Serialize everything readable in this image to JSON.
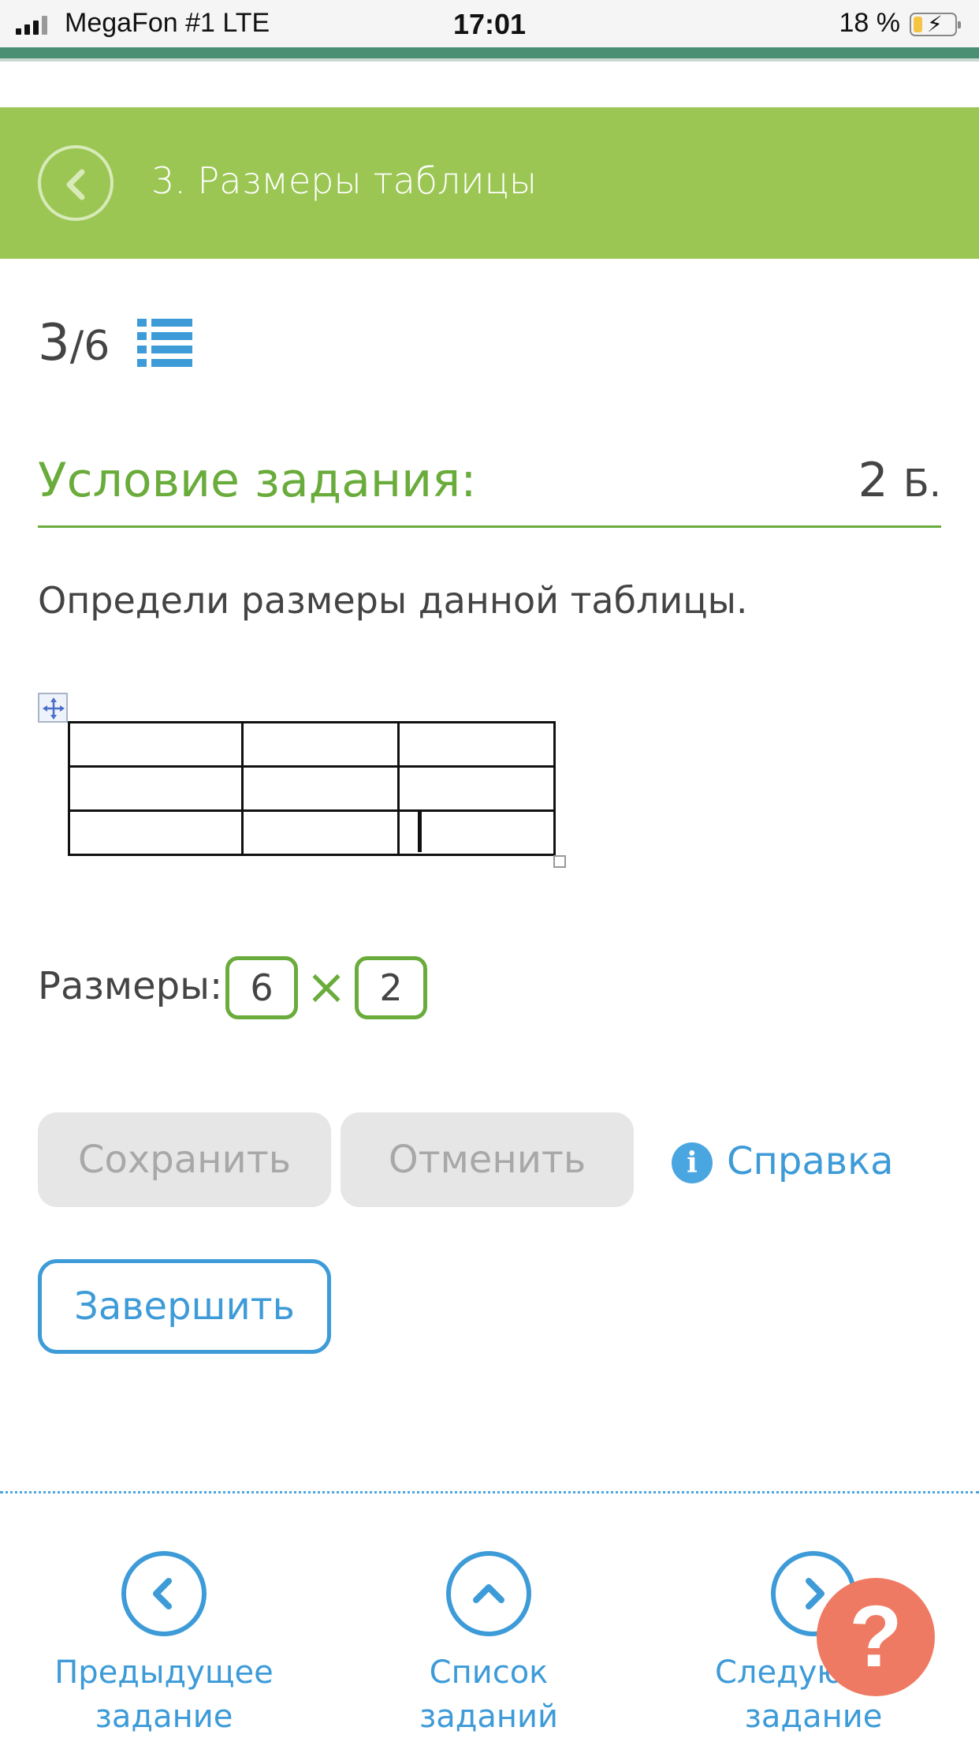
{
  "status_bar": {
    "carrier": "MegaFon #1  LTE",
    "time": "17:01",
    "battery": "18 %",
    "battery_level": 0.18
  },
  "header": {
    "title": "3. Размеры таблицы"
  },
  "progress": {
    "current": "3",
    "total": "/6"
  },
  "condition": {
    "title": "Условие задания:",
    "points": "2",
    "points_unit": "Б.",
    "question": "Определи размеры данной таблицы."
  },
  "answer": {
    "label": "Размеры:",
    "first": "6",
    "separator": "×",
    "second": "2"
  },
  "buttons": {
    "save": "Сохранить",
    "cancel": "Отменить",
    "help": "Справка",
    "finish": "Завершить"
  },
  "footer": {
    "prev": "Предыдущее задание",
    "list": "Список заданий",
    "next": "Следующее задание"
  },
  "help_fab": "?",
  "colors": {
    "accent_green": "#9bc654",
    "text_green": "#6aac3b",
    "link_blue": "#3d9bd8",
    "fab": "#ef7a63"
  }
}
